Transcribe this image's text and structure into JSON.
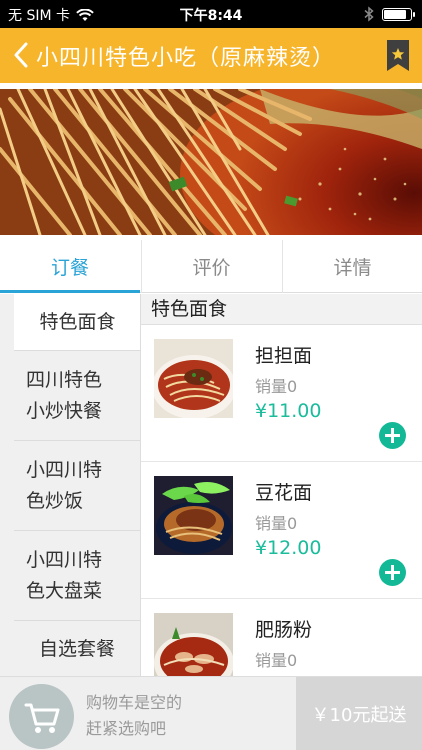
{
  "status_bar": {
    "carrier": "无 SIM 卡",
    "time": "下午8:44",
    "battery_level": 0.85
  },
  "nav": {
    "title": "小四川特色小吃（原麻辣烫）"
  },
  "tabs": [
    {
      "label": "订餐",
      "active": true
    },
    {
      "label": "评价",
      "active": false
    },
    {
      "label": "详情",
      "active": false
    }
  ],
  "categories": [
    {
      "lines": [
        "特色面食"
      ],
      "active": true
    },
    {
      "lines": [
        "四川特色",
        "小炒快餐"
      ],
      "active": false
    },
    {
      "lines": [
        "小四川特",
        "色炒饭"
      ],
      "active": false
    },
    {
      "lines": [
        "小四川特",
        "色大盘菜"
      ],
      "active": false
    },
    {
      "lines": [
        "自选套餐"
      ],
      "active": false
    }
  ],
  "section": {
    "title": "特色面食"
  },
  "dishes": [
    {
      "name": "担担面",
      "sales": "销量0",
      "price": "¥11.00"
    },
    {
      "name": "豆花面",
      "sales": "销量0",
      "price": "¥12.00"
    },
    {
      "name": "肥肠粉",
      "sales": "销量0",
      "price": ""
    }
  ],
  "cart": {
    "line1": "购物车是空的",
    "line2": "赶紧选购吧",
    "checkout": "￥10元起送"
  },
  "colors": {
    "nav": "#f7b52c",
    "accent": "#2aa3d6",
    "price": "#1abc9c",
    "add": "#13b997"
  }
}
